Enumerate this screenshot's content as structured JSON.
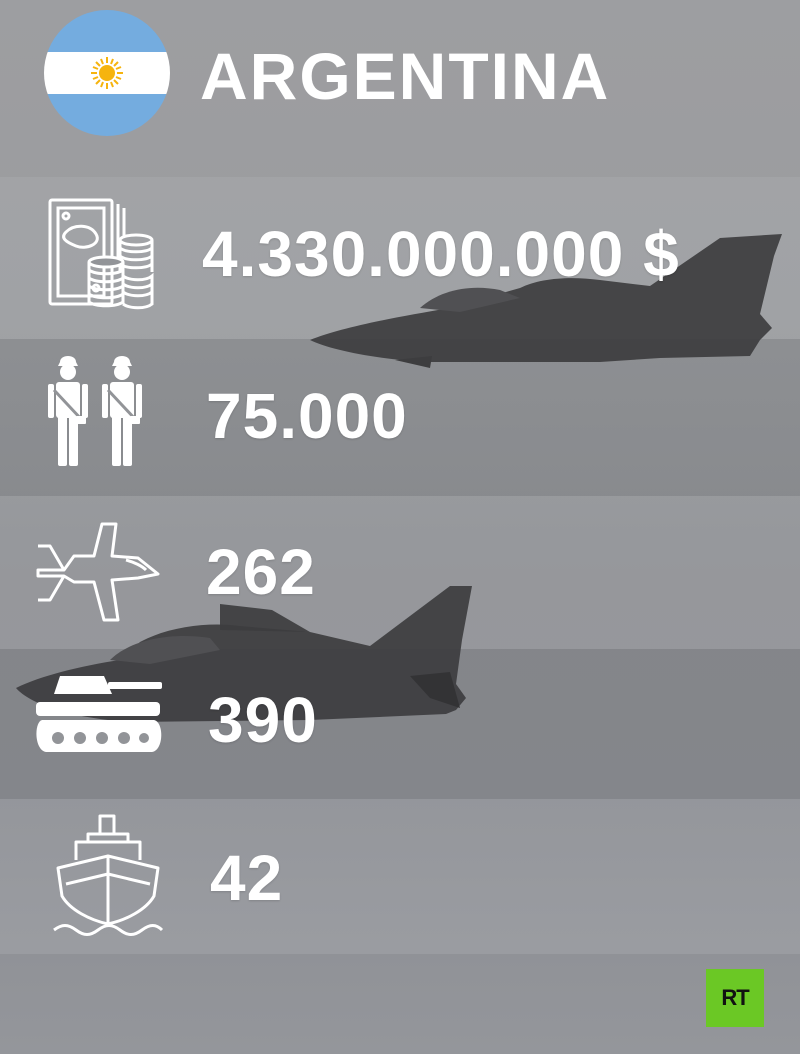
{
  "header": {
    "country": "ARGENTINA",
    "flag_icon": "argentina-flag-icon"
  },
  "stats": [
    {
      "icon": "money-coins-icon",
      "value": "4.330.000.000 $"
    },
    {
      "icon": "soldiers-icon",
      "value": "75.000"
    },
    {
      "icon": "fighter-jet-icon",
      "value": "262"
    },
    {
      "icon": "tank-icon",
      "value": "390"
    },
    {
      "icon": "ship-icon",
      "value": "42"
    }
  ],
  "logo": {
    "text": "RT",
    "color": "#6bc825"
  },
  "colors": {
    "background": "#95979b",
    "band_light": "#a2a3a6",
    "band_dark": "#86888c",
    "text": "#ffffff",
    "flag_blue": "#74acdf",
    "sun": "#f6b40e"
  }
}
